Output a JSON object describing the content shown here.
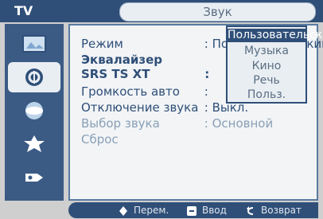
{
  "header": {
    "source_label": "TV",
    "title": "Звук"
  },
  "sidebar": {
    "items": [
      {
        "icon": "picture-icon"
      },
      {
        "icon": "sound-icon"
      },
      {
        "icon": "channel-icon"
      },
      {
        "icon": "setup-icon"
      },
      {
        "icon": "input-icon"
      }
    ],
    "active_index": 1
  },
  "menu": {
    "items": [
      {
        "label": "Режим",
        "value": ": Пользовательский"
      },
      {
        "label": "Эквалайзер",
        "value": ""
      },
      {
        "label": "SRS TS XT",
        "value": ":"
      },
      {
        "label": "Громкость авто",
        "value": ":"
      },
      {
        "label": "Отключение звука",
        "value": ": Выкл."
      },
      {
        "label": "Выбор звука",
        "value": ": Основной"
      },
      {
        "label": "Сброс",
        "value": ""
      }
    ]
  },
  "dropdown": {
    "options": [
      "Пользовательский",
      "Музыка",
      "Кино",
      "Речь",
      "Польз."
    ],
    "selected_index": 0
  },
  "bottom_bar": {
    "move_label": "Перем.",
    "enter_label": "Ввод",
    "return_label": "Возврат"
  },
  "colors": {
    "accent": "#2f4f78",
    "panel": "#f2f4f6"
  }
}
